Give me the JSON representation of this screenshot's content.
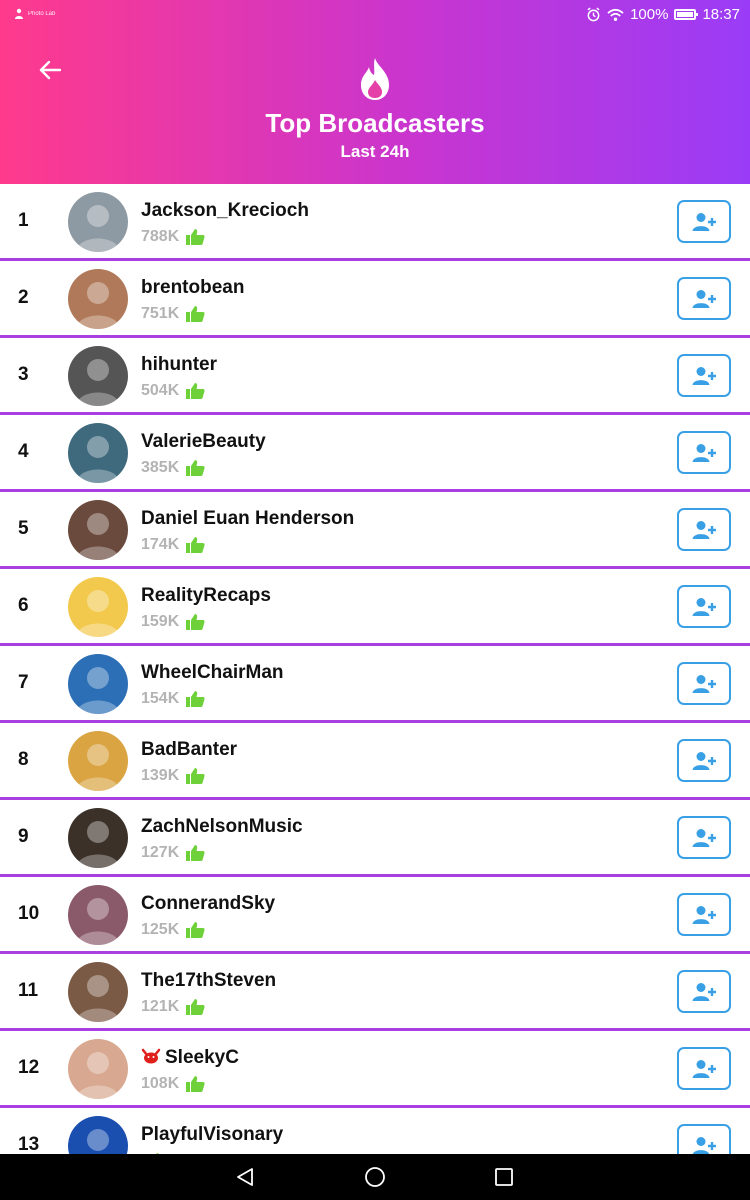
{
  "status_bar": {
    "notification_text": "Photo Lab",
    "battery": "100%",
    "time": "18:37"
  },
  "header": {
    "title": "Top Broadcasters",
    "subtitle": "Last 24h",
    "back_icon": "arrow-left-icon",
    "logo_icon": "flame-icon"
  },
  "colors": {
    "gradient_start": "#ff3a8c",
    "gradient_end": "#9a3cf7",
    "row_divider": "#a83fe0",
    "follow_button": "#3aa0e6",
    "like_green": "#6fd13a",
    "like_count": "#b3b3b3"
  },
  "broadcasters": [
    {
      "rank": "1",
      "name": "Jackson_Krecioch",
      "likes": "788K",
      "avatar_color": "#8e9aa3"
    },
    {
      "rank": "2",
      "name": "brentobean",
      "likes": "751K",
      "avatar_color": "#b07a5a"
    },
    {
      "rank": "3",
      "name": "hihunter",
      "likes": "504K",
      "avatar_color": "#555555"
    },
    {
      "rank": "4",
      "name": "ValerieBeauty",
      "likes": "385K",
      "avatar_color": "#3f6a7e"
    },
    {
      "rank": "5",
      "name": "Daniel Euan Henderson",
      "likes": "174K",
      "avatar_color": "#6b4a3e"
    },
    {
      "rank": "6",
      "name": "RealityRecaps",
      "likes": "159K",
      "avatar_color": "#f2c94c"
    },
    {
      "rank": "7",
      "name": "WheelChairMan",
      "likes": "154K",
      "avatar_color": "#2c6fb6"
    },
    {
      "rank": "8",
      "name": "BadBanter",
      "likes": "139K",
      "avatar_color": "#d9a441"
    },
    {
      "rank": "9",
      "name": "ZachNelsonMusic",
      "likes": "127K",
      "avatar_color": "#3b3129"
    },
    {
      "rank": "10",
      "name": "ConnerandSky",
      "likes": "125K",
      "avatar_color": "#8a5a6a"
    },
    {
      "rank": "11",
      "name": "The17thSteven",
      "likes": "121K",
      "avatar_color": "#7a5a45"
    },
    {
      "rank": "12",
      "name": "SleekyC",
      "likes": "108K",
      "avatar_color": "#d8a890",
      "badge_icon": "devil-icon"
    },
    {
      "rank": "13",
      "name": "PlayfulVisonary",
      "likes": "",
      "avatar_color": "#1a4fb0"
    }
  ],
  "nav_bar": {
    "back_icon": "nav-back-icon",
    "home_icon": "nav-home-icon",
    "recents_icon": "nav-recents-icon"
  }
}
